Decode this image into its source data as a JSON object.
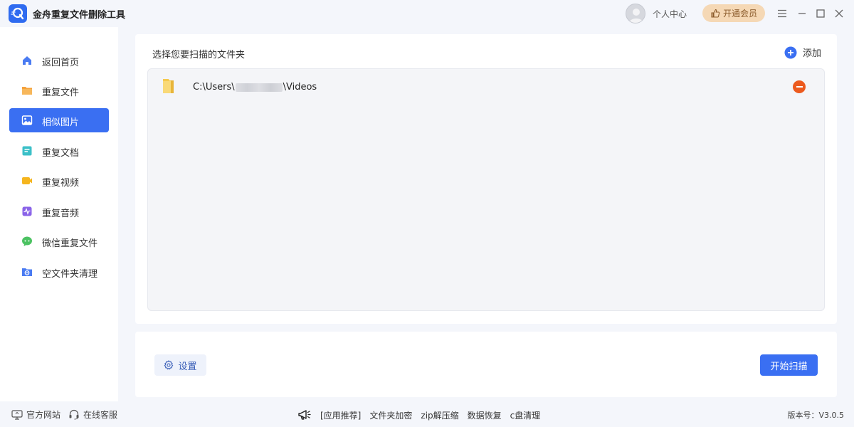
{
  "app": {
    "title": "金舟重复文件删除工具",
    "accent": "#3a6ff2"
  },
  "header": {
    "user_center": "个人中心",
    "vip_label": "开通会员",
    "icons": [
      "menu-icon",
      "minimize-icon",
      "maximize-icon",
      "close-icon"
    ]
  },
  "sidebar": {
    "items": [
      {
        "label": "返回首页",
        "icon": "home-icon",
        "active": false
      },
      {
        "label": "重复文件",
        "icon": "folder-icon",
        "active": false
      },
      {
        "label": "相似图片",
        "icon": "image-icon",
        "active": true
      },
      {
        "label": "重复文档",
        "icon": "document-icon",
        "active": false
      },
      {
        "label": "重复视频",
        "icon": "video-icon",
        "active": false
      },
      {
        "label": "重复音频",
        "icon": "audio-icon",
        "active": false
      },
      {
        "label": "微信重复文件",
        "icon": "wechat-icon",
        "active": false
      },
      {
        "label": "空文件夹清理",
        "icon": "empty-folder-icon",
        "active": false
      }
    ]
  },
  "main": {
    "heading": "选择您要扫描的文件夹",
    "add_label": "添加",
    "folders": [
      {
        "path_prefix": "C:\\Users\\",
        "path_suffix": "\\Videos"
      }
    ]
  },
  "bottom": {
    "settings_label": "设置",
    "start_label": "开始扫描"
  },
  "footer": {
    "official_site": "官方网站",
    "online_service": "在线客服",
    "recommend": "[应用推荐]",
    "links": [
      "文件夹加密",
      "zip解压缩",
      "数据恢复",
      "c盘清理"
    ],
    "version": "版本号：V3.0.5"
  }
}
